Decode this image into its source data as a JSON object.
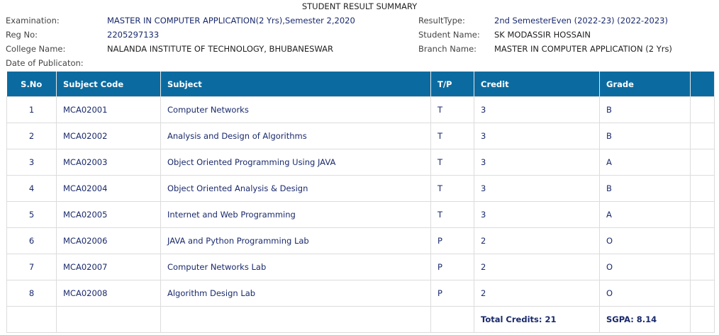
{
  "title": "STUDENT RESULT SUMMARY",
  "info_left": [
    {
      "label": "Examination:",
      "value": "MASTER IN COMPUTER APPLICATION(2 Yrs),Semester 2,2020"
    },
    {
      "label": "Reg No:",
      "value": "2205297133"
    },
    {
      "label": "College Name:",
      "value": "NALANDA INSTITUTE OF TECHNOLOGY, BHUBANESWAR"
    },
    {
      "label": "Date of Publicaton:",
      "value": ""
    }
  ],
  "info_right": [
    {
      "label": "ResultType:",
      "value": "2nd SemesterEven (2022-23) (2022-2023)"
    },
    {
      "label": "Student Name:",
      "value": "SK MODASSIR HOSSAIN"
    },
    {
      "label": "Branch Name:",
      "value": "MASTER IN COMPUTER APPLICATION (2 Yrs)"
    }
  ],
  "table": {
    "headers": [
      "S.No",
      "Subject Code",
      "Subject",
      "T/P",
      "Credit",
      "Grade",
      ""
    ],
    "rows": [
      [
        "1",
        "MCA02001",
        "Computer Networks",
        "T",
        "3",
        "B"
      ],
      [
        "2",
        "MCA02002",
        "Analysis and Design of Algorithms",
        "T",
        "3",
        "B"
      ],
      [
        "3",
        "MCA02003",
        "Object Oriented Programming Using JAVA",
        "T",
        "3",
        "A"
      ],
      [
        "4",
        "MCA02004",
        "Object Oriented Analysis & Design",
        "T",
        "3",
        "B"
      ],
      [
        "5",
        "MCA02005",
        "Internet and Web Programming",
        "T",
        "3",
        "A"
      ],
      [
        "6",
        "MCA02006",
        "JAVA and Python Programming Lab",
        "P",
        "2",
        "O"
      ],
      [
        "7",
        "MCA02007",
        "Computer Networks Lab",
        "P",
        "2",
        "O"
      ],
      [
        "8",
        "MCA02008",
        "Algorithm Design Lab",
        "P",
        "2",
        "O"
      ]
    ],
    "footer": {
      "total_credits": "Total Credits: 21",
      "sgpa": "SGPA: 8.14"
    }
  },
  "colors": {
    "header_bg": "#0b6ba0",
    "value_text": "#1a2a6c"
  }
}
